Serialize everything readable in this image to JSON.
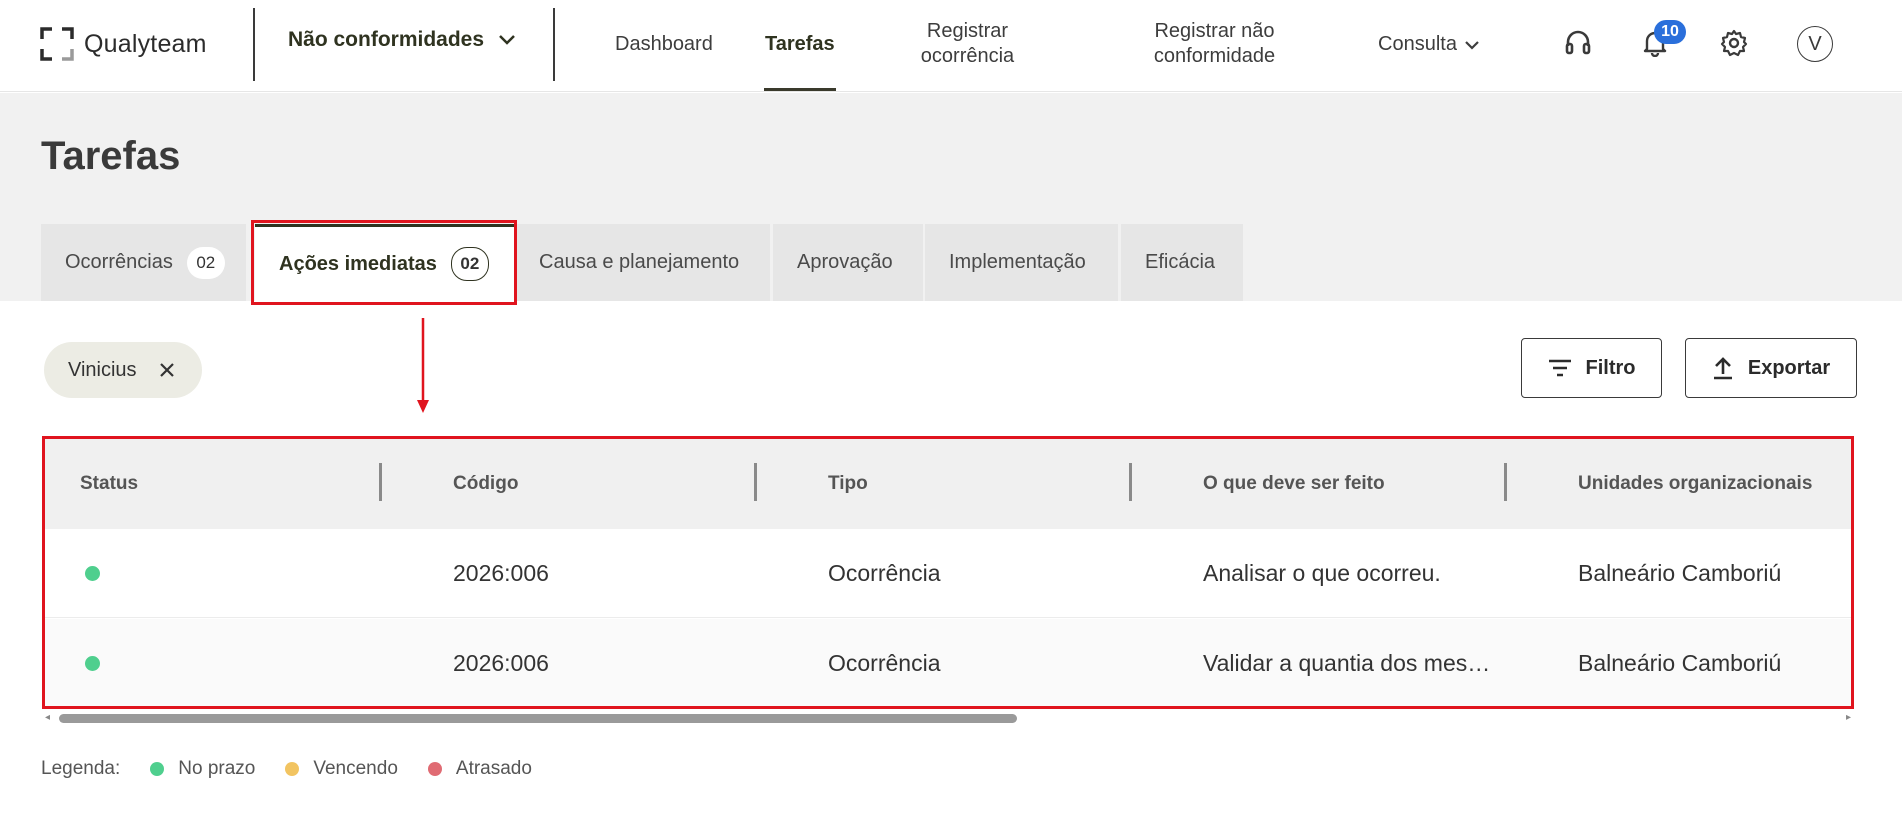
{
  "header": {
    "brand": "Qualyteam",
    "module": "Não conformidades",
    "nav": {
      "dashboard": "Dashboard",
      "tarefas": "Tarefas",
      "registrar_ocorrencia_1": "Registrar",
      "registrar_ocorrencia_2": "ocorrência",
      "registrar_nc_1": "Registrar não",
      "registrar_nc_2": "conformidade",
      "consulta": "Consulta"
    },
    "notifications_count": "10",
    "avatar_initial": "V",
    "icons": [
      "headset-icon",
      "bell-icon",
      "gear-icon"
    ]
  },
  "page": {
    "title": "Tarefas"
  },
  "tabs": [
    {
      "label": "Ocorrências",
      "count": "02"
    },
    {
      "label": "Ações imediatas",
      "count": "02",
      "active": true
    },
    {
      "label": "Causa e planejamento"
    },
    {
      "label": "Aprovação"
    },
    {
      "label": "Implementação"
    },
    {
      "label": "Eficácia"
    }
  ],
  "filter_chip": {
    "label": "Vinicius"
  },
  "actions": {
    "filter": "Filtro",
    "export": "Exportar"
  },
  "table": {
    "columns": [
      "Status",
      "Código",
      "Tipo",
      "O que deve ser feito",
      "Unidades organizacionais"
    ],
    "rows": [
      {
        "status": "No prazo",
        "codigo": "2026:006",
        "tipo": "Ocorrência",
        "oque": "Analisar o que ocorreu.",
        "unidade": "Balneário Camboriú"
      },
      {
        "status": "No prazo",
        "codigo": "2026:006",
        "tipo": "Ocorrência",
        "oque": "Validar a quantia dos mes…",
        "unidade": "Balneário Camboriú"
      }
    ]
  },
  "legend": {
    "title": "Legenda:",
    "items": [
      {
        "label": "No prazo",
        "color": "#4fcf8e"
      },
      {
        "label": "Vencendo",
        "color": "#f2c461"
      },
      {
        "label": "Atrasado",
        "color": "#e06b73"
      }
    ]
  },
  "colors": {
    "accent": "#2f3320",
    "highlight": "#e0141e",
    "status_ok": "#4fcf8e",
    "badge": "#2a6fdb"
  }
}
